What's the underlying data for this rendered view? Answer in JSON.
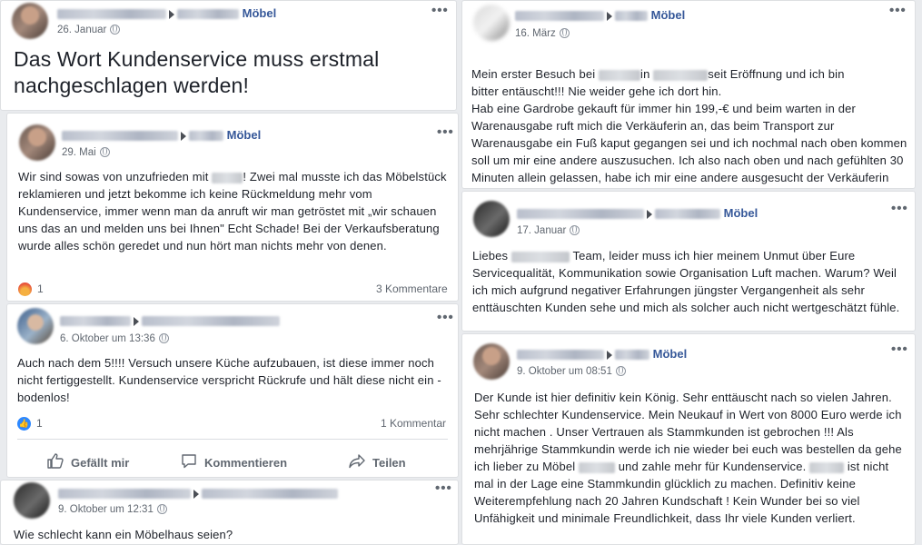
{
  "posts": {
    "p1": {
      "page": "Möbel",
      "date": "26. Januar",
      "text": "Das Wort Kundenservice muss erstmal nachgeschlagen werden!"
    },
    "p2": {
      "page": "Möbel",
      "date": "29. Mai",
      "text_a": "Wir sind sowas von unzufrieden mit",
      "text_b": "! Zwei mal musste ich das Möbelstück reklamieren und jetzt bekomme ich keine Rückmeldung mehr vom Kundenservice, immer wenn man da anruft wir man getröstet mit „wir schauen uns das an und melden uns bei Ihnen\" Echt Schade! Bei der Verkaufsberatung wurde alles schön geredet und nun hört man nichts mehr von denen.",
      "reactions": "1",
      "comments": "3 Kommentare"
    },
    "p3": {
      "date": "6. Oktober um 13:36",
      "text": "Auch nach dem 5!!!! Versuch unsere Küche aufzubauen, ist diese immer noch nicht fertiggestellt. Kundenservice verspricht Rückrufe und hält diese nicht ein - bodenlos!",
      "reactions": "1",
      "comments": "1 Kommentar",
      "actions": {
        "like": "Gefällt mir",
        "comment": "Kommentieren",
        "share": "Teilen"
      }
    },
    "p4": {
      "date": "9. Oktober um 12:31",
      "text": "Wie schlecht kann ein Möbelhaus seien?"
    },
    "p5": {
      "page": "Möbel",
      "date": "16. März",
      "line1_a": "Mein erster Besuch bei",
      "line1_b": "in",
      "line1_c": "seit Eröffnung und ich bin",
      "rest": "bitter entäuscht!!! Nie weider gehe ich dort hin.\nHab eine Gardrobe gekauft für immer hin 199,-€ und beim warten in der Warenausgabe ruft mich die Verkäuferin an, das beim Transport zur Warenausgabe ein Fuß kaput gegangen sei und ich nochmal nach oben kommen soll um mir eine andere auszusuchen. Ich also nach oben und nach gefühlten 30 Minuten allein gelassen, habe ich mir eine andere ausgesucht der Verkäuferin vor die Nase gesetzt, bescheid gegeben mit"
    },
    "p6": {
      "page": "Möbel",
      "date": "17. Januar",
      "text_a": "Liebes",
      "text_b": "Team, leider muss ich hier meinem Unmut über Eure Servicequalität, Kommunikation sowie Organisation Luft machen. Warum? Weil ich mich aufgrund negativer Erfahrungen jüngster Vergangenheit als sehr enttäuschten Kunden sehe und mich als solcher auch nicht wertgeschätzt fühle."
    },
    "p7": {
      "page": "Möbel",
      "date": "9. Oktober um 08:51",
      "text_a": "Der Kunde ist hier definitiv kein König. Sehr enttäuscht nach so vielen Jahren. Sehr schlechter Kundenservice. Mein Neukauf in Wert von 8000 Euro werde ich nicht machen . Unser Vertrauen als Stammkunden ist gebrochen !!! Als mehrjährige Stammkundin werde ich nie wieder bei euch was bestellen da gehe ich lieber zu Möbel",
      "text_b": "und zahle mehr für Kundenservice.",
      "text_c": "ist nicht mal in der Lage eine Stammkundin glücklich zu machen. Definitiv keine Weiterempfehlung nach 20 Jahren Kundschaft ! Kein Wunder bei so viel Unfähigkeit und minimale Freundlichkeit, dass Ihr viele Kunden verliert."
    }
  },
  "more_glyph": "•••"
}
